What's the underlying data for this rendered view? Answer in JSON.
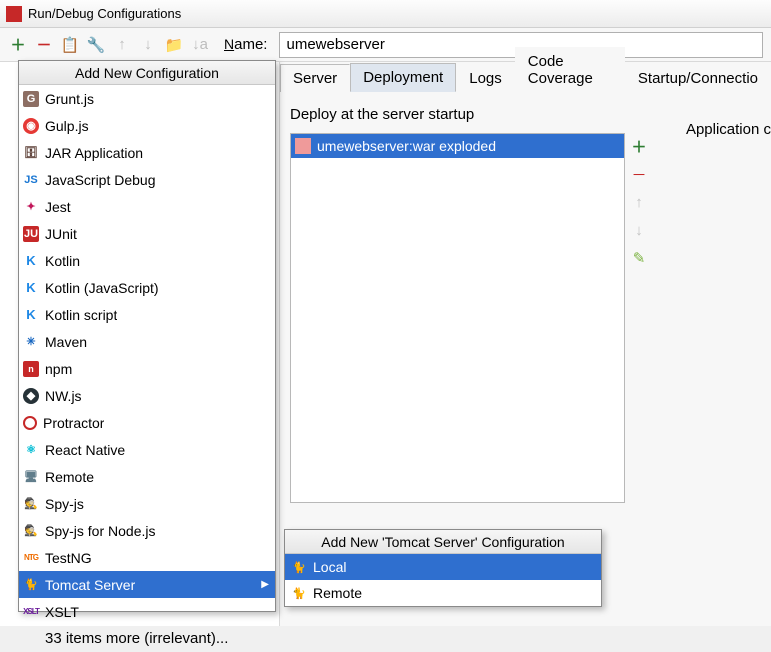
{
  "window": {
    "title": "Run/Debug Configurations"
  },
  "toolbar": {
    "name_label": "Name:",
    "name_value": "umewebserver"
  },
  "popup": {
    "title": "Add New Configuration",
    "items": [
      {
        "key": "gruntjs",
        "label": "Grunt.js",
        "glyph": "G"
      },
      {
        "key": "gulpjs",
        "label": "Gulp.js",
        "glyph": "◉"
      },
      {
        "key": "jarapplication",
        "label": "JAR Application",
        "glyph": "🗄"
      },
      {
        "key": "javascriptdebug",
        "label": "JavaScript Debug",
        "glyph": "JS"
      },
      {
        "key": "jest",
        "label": "Jest",
        "glyph": "✦"
      },
      {
        "key": "junit",
        "label": "JUnit",
        "glyph": "JU"
      },
      {
        "key": "kotlin",
        "label": "Kotlin",
        "glyph": "K"
      },
      {
        "key": "kotlinjavascript",
        "label": "Kotlin (JavaScript)",
        "glyph": "K"
      },
      {
        "key": "kotlinscript",
        "label": "Kotlin script",
        "glyph": "K"
      },
      {
        "key": "maven",
        "label": "Maven",
        "glyph": "✳"
      },
      {
        "key": "npm",
        "label": "npm",
        "glyph": "n"
      },
      {
        "key": "nwjs",
        "label": "NW.js",
        "glyph": "◆"
      },
      {
        "key": "protractor",
        "label": "Protractor",
        "glyph": ""
      },
      {
        "key": "reactnative",
        "label": "React Native",
        "glyph": "⚛"
      },
      {
        "key": "remote",
        "label": "Remote",
        "glyph": "🖥"
      },
      {
        "key": "spyjs",
        "label": "Spy-js",
        "glyph": "🕵"
      },
      {
        "key": "spyjsfornodejs",
        "label": "Spy-js for Node.js",
        "glyph": "🕵"
      },
      {
        "key": "testng",
        "label": "TestNG",
        "glyph": "NTG"
      },
      {
        "key": "tomcatserver",
        "label": "Tomcat Server",
        "glyph": "🐈",
        "selected": true,
        "submenu": true
      },
      {
        "key": "xslt",
        "label": "XSLT",
        "glyph": "XSLT"
      }
    ],
    "more_label": "33 items more (irrelevant)..."
  },
  "submenu": {
    "title": "Add New 'Tomcat Server' Configuration",
    "items": [
      {
        "key": "local",
        "label": "Local",
        "glyph": "🐈",
        "selected": true
      },
      {
        "key": "remote2",
        "label": "Remote",
        "glyph": "🐈"
      }
    ]
  },
  "tabs": {
    "items": [
      {
        "key": "server",
        "label": "Server",
        "truncatedLeft": true
      },
      {
        "key": "deployment",
        "label": "Deployment",
        "active": true
      },
      {
        "key": "logs",
        "label": "Logs"
      },
      {
        "key": "codecoverage",
        "label": "Code Coverage"
      },
      {
        "key": "startupconnection",
        "label": "Startup/Connectio"
      }
    ]
  },
  "deployment": {
    "section_label": "Deploy at the server startup",
    "artifact": "umewebserver:war exploded",
    "right_panel_cut": "Application c"
  }
}
